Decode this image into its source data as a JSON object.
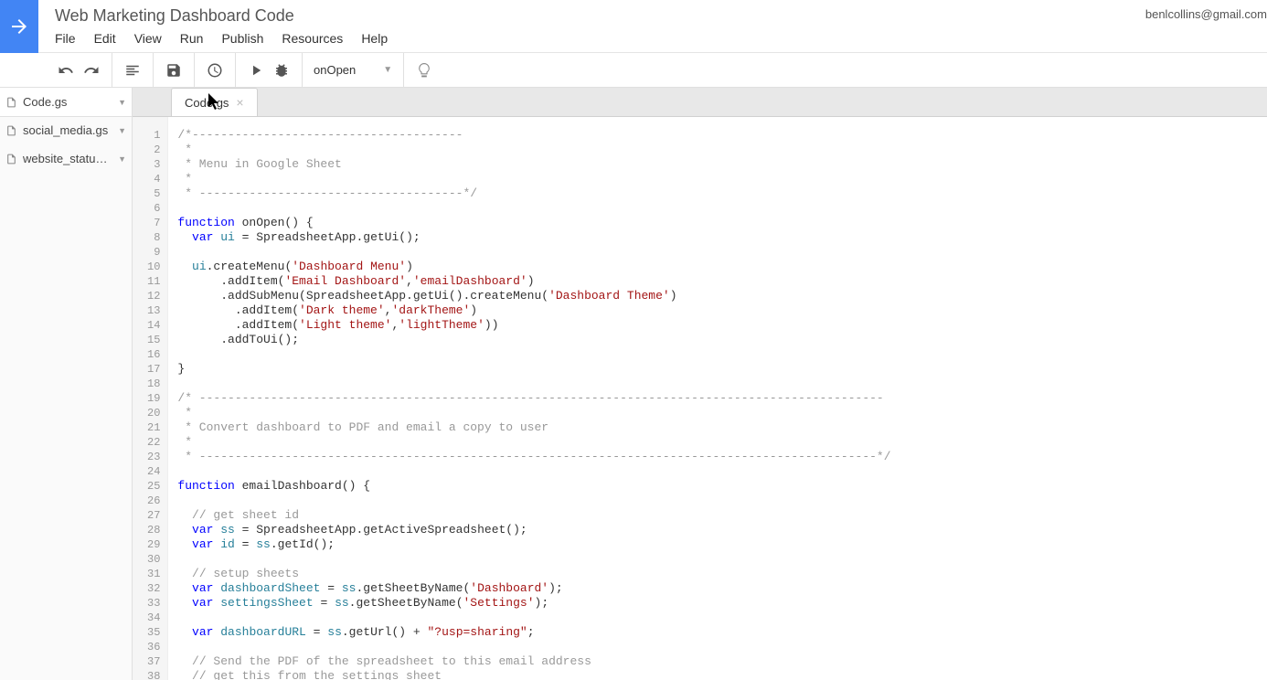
{
  "header": {
    "title": "Web Marketing Dashboard Code",
    "user_email": "benlcollins@gmail.com",
    "menu": [
      "File",
      "Edit",
      "View",
      "Run",
      "Publish",
      "Resources",
      "Help"
    ]
  },
  "toolbar": {
    "function_selected": "onOpen"
  },
  "sidebar": {
    "files": [
      {
        "name": "Code.gs",
        "active": true
      },
      {
        "name": "social_media.gs",
        "active": false
      },
      {
        "name": "website_statu…",
        "active": false
      }
    ]
  },
  "tabs": [
    {
      "label": "Code.gs"
    }
  ],
  "code": {
    "lines": [
      {
        "n": 1,
        "tokens": [
          {
            "t": "/*--------------------------------------",
            "c": "comment"
          }
        ]
      },
      {
        "n": 2,
        "tokens": [
          {
            "t": " *",
            "c": "comment"
          }
        ]
      },
      {
        "n": 3,
        "tokens": [
          {
            "t": " * Menu in Google Sheet",
            "c": "comment"
          }
        ]
      },
      {
        "n": 4,
        "tokens": [
          {
            "t": " *",
            "c": "comment"
          }
        ]
      },
      {
        "n": 5,
        "tokens": [
          {
            "t": " * -------------------------------------*/",
            "c": "comment"
          }
        ]
      },
      {
        "n": 6,
        "tokens": []
      },
      {
        "n": 7,
        "tokens": [
          {
            "t": "function",
            "c": "keyword"
          },
          {
            "t": " onOpen() {",
            "c": ""
          }
        ]
      },
      {
        "n": 8,
        "tokens": [
          {
            "t": "  ",
            "c": ""
          },
          {
            "t": "var",
            "c": "keyword"
          },
          {
            "t": " ",
            "c": ""
          },
          {
            "t": "ui",
            "c": "ident"
          },
          {
            "t": " = SpreadsheetApp.getUi();",
            "c": ""
          }
        ]
      },
      {
        "n": 9,
        "tokens": []
      },
      {
        "n": 10,
        "tokens": [
          {
            "t": "  ",
            "c": ""
          },
          {
            "t": "ui",
            "c": "ident"
          },
          {
            "t": ".createMenu(",
            "c": ""
          },
          {
            "t": "'Dashboard Menu'",
            "c": "string"
          },
          {
            "t": ")",
            "c": ""
          }
        ]
      },
      {
        "n": 11,
        "tokens": [
          {
            "t": "      .addItem(",
            "c": ""
          },
          {
            "t": "'Email Dashboard'",
            "c": "string"
          },
          {
            "t": ",",
            "c": ""
          },
          {
            "t": "'emailDashboard'",
            "c": "string"
          },
          {
            "t": ")",
            "c": ""
          }
        ]
      },
      {
        "n": 12,
        "tokens": [
          {
            "t": "      .addSubMenu(SpreadsheetApp.getUi().createMenu(",
            "c": ""
          },
          {
            "t": "'Dashboard Theme'",
            "c": "string"
          },
          {
            "t": ")",
            "c": ""
          }
        ]
      },
      {
        "n": 13,
        "tokens": [
          {
            "t": "        .addItem(",
            "c": ""
          },
          {
            "t": "'Dark theme'",
            "c": "string"
          },
          {
            "t": ",",
            "c": ""
          },
          {
            "t": "'darkTheme'",
            "c": "string"
          },
          {
            "t": ")",
            "c": ""
          }
        ]
      },
      {
        "n": 14,
        "tokens": [
          {
            "t": "        .addItem(",
            "c": ""
          },
          {
            "t": "'Light theme'",
            "c": "string"
          },
          {
            "t": ",",
            "c": ""
          },
          {
            "t": "'lightTheme'",
            "c": "string"
          },
          {
            "t": "))",
            "c": ""
          }
        ]
      },
      {
        "n": 15,
        "tokens": [
          {
            "t": "      .addToUi();",
            "c": ""
          }
        ]
      },
      {
        "n": 16,
        "tokens": []
      },
      {
        "n": 17,
        "tokens": [
          {
            "t": "}",
            "c": ""
          }
        ]
      },
      {
        "n": 18,
        "tokens": []
      },
      {
        "n": 19,
        "tokens": [
          {
            "t": "/* ------------------------------------------------------------------------------------------------",
            "c": "comment"
          }
        ]
      },
      {
        "n": 20,
        "tokens": [
          {
            "t": " *",
            "c": "comment"
          }
        ]
      },
      {
        "n": 21,
        "tokens": [
          {
            "t": " * Convert dashboard to PDF and email a copy to user",
            "c": "comment"
          }
        ]
      },
      {
        "n": 22,
        "tokens": [
          {
            "t": " *",
            "c": "comment"
          }
        ]
      },
      {
        "n": 23,
        "tokens": [
          {
            "t": " * -----------------------------------------------------------------------------------------------*/",
            "c": "comment"
          }
        ]
      },
      {
        "n": 24,
        "tokens": []
      },
      {
        "n": 25,
        "tokens": [
          {
            "t": "function",
            "c": "keyword"
          },
          {
            "t": " emailDashboard() {",
            "c": ""
          }
        ]
      },
      {
        "n": 26,
        "tokens": []
      },
      {
        "n": 27,
        "tokens": [
          {
            "t": "  ",
            "c": ""
          },
          {
            "t": "// get sheet id",
            "c": "comment"
          }
        ]
      },
      {
        "n": 28,
        "tokens": [
          {
            "t": "  ",
            "c": ""
          },
          {
            "t": "var",
            "c": "keyword"
          },
          {
            "t": " ",
            "c": ""
          },
          {
            "t": "ss",
            "c": "ident"
          },
          {
            "t": " = SpreadsheetApp.getActiveSpreadsheet();",
            "c": ""
          }
        ]
      },
      {
        "n": 29,
        "tokens": [
          {
            "t": "  ",
            "c": ""
          },
          {
            "t": "var",
            "c": "keyword"
          },
          {
            "t": " ",
            "c": ""
          },
          {
            "t": "id",
            "c": "ident"
          },
          {
            "t": " = ",
            "c": ""
          },
          {
            "t": "ss",
            "c": "ident"
          },
          {
            "t": ".getId();",
            "c": ""
          }
        ]
      },
      {
        "n": 30,
        "tokens": []
      },
      {
        "n": 31,
        "tokens": [
          {
            "t": "  ",
            "c": ""
          },
          {
            "t": "// setup sheets",
            "c": "comment"
          }
        ]
      },
      {
        "n": 32,
        "tokens": [
          {
            "t": "  ",
            "c": ""
          },
          {
            "t": "var",
            "c": "keyword"
          },
          {
            "t": " ",
            "c": ""
          },
          {
            "t": "dashboardSheet",
            "c": "ident"
          },
          {
            "t": " = ",
            "c": ""
          },
          {
            "t": "ss",
            "c": "ident"
          },
          {
            "t": ".getSheetByName(",
            "c": ""
          },
          {
            "t": "'Dashboard'",
            "c": "string"
          },
          {
            "t": ");",
            "c": ""
          }
        ]
      },
      {
        "n": 33,
        "tokens": [
          {
            "t": "  ",
            "c": ""
          },
          {
            "t": "var",
            "c": "keyword"
          },
          {
            "t": " ",
            "c": ""
          },
          {
            "t": "settingsSheet",
            "c": "ident"
          },
          {
            "t": " = ",
            "c": ""
          },
          {
            "t": "ss",
            "c": "ident"
          },
          {
            "t": ".getSheetByName(",
            "c": ""
          },
          {
            "t": "'Settings'",
            "c": "string"
          },
          {
            "t": ");",
            "c": ""
          }
        ]
      },
      {
        "n": 34,
        "tokens": []
      },
      {
        "n": 35,
        "tokens": [
          {
            "t": "  ",
            "c": ""
          },
          {
            "t": "var",
            "c": "keyword"
          },
          {
            "t": " ",
            "c": ""
          },
          {
            "t": "dashboardURL",
            "c": "ident"
          },
          {
            "t": " = ",
            "c": ""
          },
          {
            "t": "ss",
            "c": "ident"
          },
          {
            "t": ".getUrl() + ",
            "c": ""
          },
          {
            "t": "\"?usp=sharing\"",
            "c": "string"
          },
          {
            "t": ";",
            "c": ""
          }
        ]
      },
      {
        "n": 36,
        "tokens": []
      },
      {
        "n": 37,
        "tokens": [
          {
            "t": "  ",
            "c": ""
          },
          {
            "t": "// Send the PDF of the spreadsheet to this email address",
            "c": "comment"
          }
        ]
      },
      {
        "n": 38,
        "tokens": [
          {
            "t": "  ",
            "c": ""
          },
          {
            "t": "// get this from the settings sheet",
            "c": "comment"
          }
        ]
      }
    ]
  }
}
